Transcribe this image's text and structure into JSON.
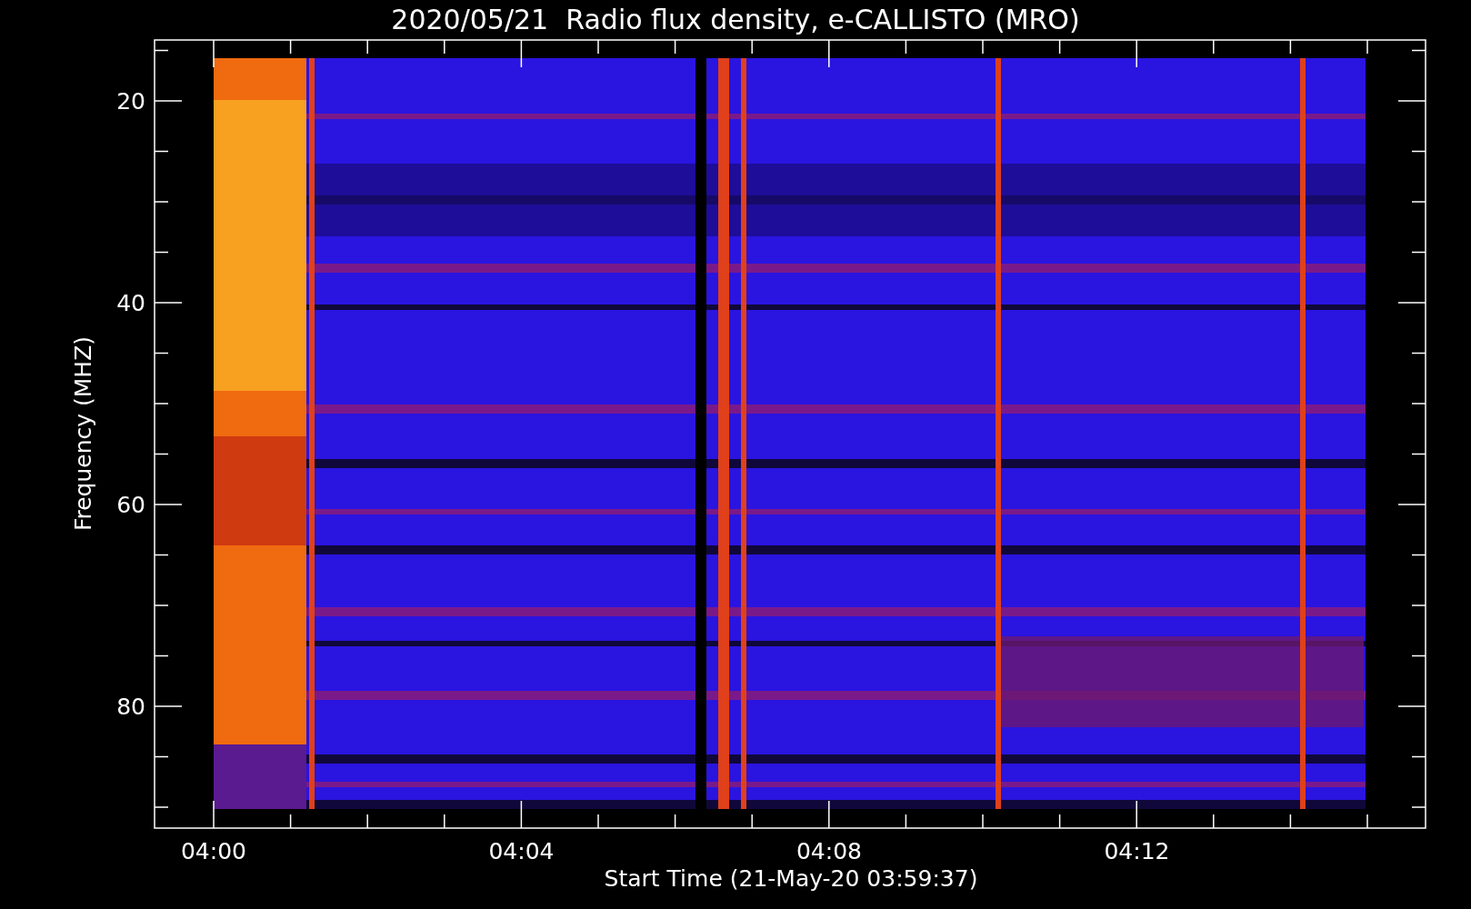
{
  "title": "2020/05/21  Radio flux density, e-CALLISTO (MRO)",
  "y_axis": {
    "label": "Frequency (MHZ)",
    "ticks": [
      "20",
      "40",
      "60",
      "80"
    ]
  },
  "x_axis": {
    "label": "Start Time (21-May-20 03:59:37)",
    "ticks": [
      "04:00",
      "04:04",
      "04:08",
      "04:12"
    ]
  }
}
